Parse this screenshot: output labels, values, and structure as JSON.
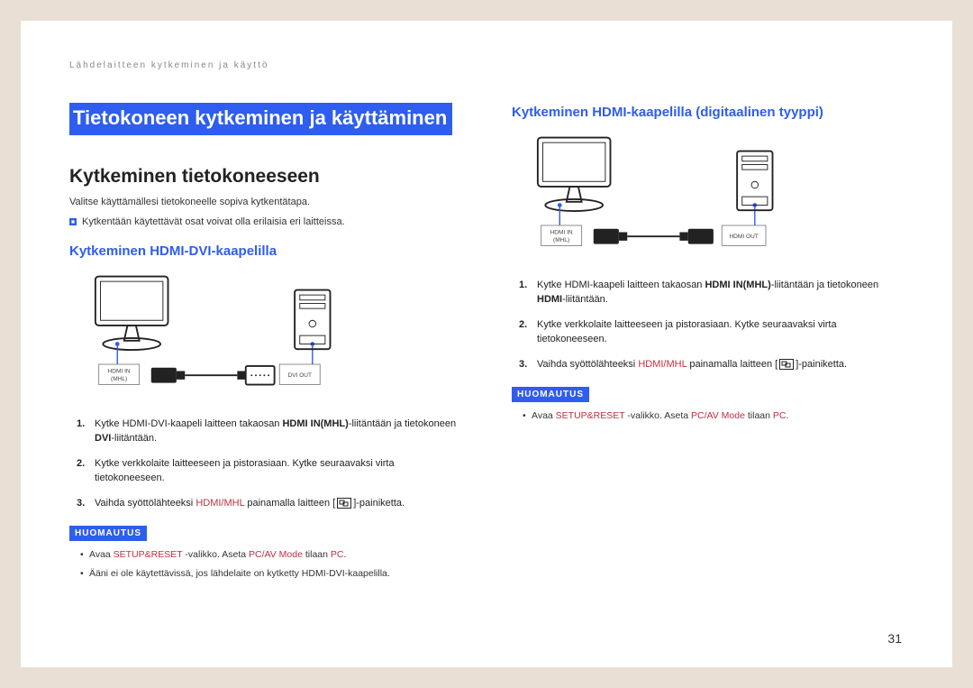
{
  "breadcrumb": "Lähdelaitteen kytkeminen ja käyttö",
  "titleBar": "Tietokoneen kytkeminen ja käyttäminen",
  "left": {
    "h2": "Kytkeminen tietokoneeseen",
    "lead": "Valitse käyttämällesi tietokoneelle sopiva kytkentätapa.",
    "bullet": "Kytkentään käytettävät osat voivat olla erilaisia eri laitteissa.",
    "h3": "Kytkeminen HDMI-DVI-kaapelilla",
    "fig": {
      "leftPort1": "HDMI IN",
      "leftPort2": "(MHL)",
      "rightPort": "DVI OUT"
    },
    "step1_a": "Kytke HDMI-DVI-kaapeli laitteen takaosan ",
    "step1_b": "HDMI IN(MHL)",
    "step1_c": "-liitäntään ja tietokoneen ",
    "step1_d": "DVI",
    "step1_e": "-liitäntään.",
    "step2": "Kytke verkkolaite laitteeseen ja pistorasiaan. Kytke seuraavaksi virta tietokoneeseen.",
    "step3_a": "Vaihda syöttölähteeksi ",
    "step3_b": "HDMI/MHL",
    "step3_c": " painamalla laitteen ",
    "step3_d": "-painiketta.",
    "noteBadge": "HUOMAUTUS",
    "note1_a": "Avaa ",
    "note1_b": "SETUP&RESET",
    "note1_c": " -valikko. Aseta ",
    "note1_d": "PC/AV Mode",
    "note1_e": " tilaan ",
    "note1_f": "PC",
    "note1_g": ".",
    "note2": "Ääni ei ole käytettävissä, jos lähdelaite on kytketty HDMI-DVI-kaapelilla."
  },
  "right": {
    "h3": "Kytkeminen HDMI-kaapelilla (digitaalinen tyyppi)",
    "fig": {
      "leftPort1": "HDMI IN",
      "leftPort2": "(MHL)",
      "rightPort": "HDMI OUT"
    },
    "step1_a": "Kytke HDMI-kaapeli laitteen takaosan ",
    "step1_b": "HDMI IN(MHL)",
    "step1_c": "-liitäntään ja tietokoneen ",
    "step1_d": "HDMI",
    "step1_e": "-liitäntään.",
    "step2": "Kytke verkkolaite laitteeseen ja pistorasiaan. Kytke seuraavaksi virta tietokoneeseen.",
    "step3_a": "Vaihda syöttölähteeksi ",
    "step3_b": "HDMI/MHL",
    "step3_c": " painamalla laitteen ",
    "step3_d": "-painiketta.",
    "noteBadge": "HUOMAUTUS",
    "note1_a": "Avaa ",
    "note1_b": "SETUP&RESET",
    "note1_c": " -valikko. Aseta ",
    "note1_d": "PC/AV Mode",
    "note1_e": " tilaan ",
    "note1_f": "PC",
    "note1_g": "."
  },
  "pageNumber": "31"
}
